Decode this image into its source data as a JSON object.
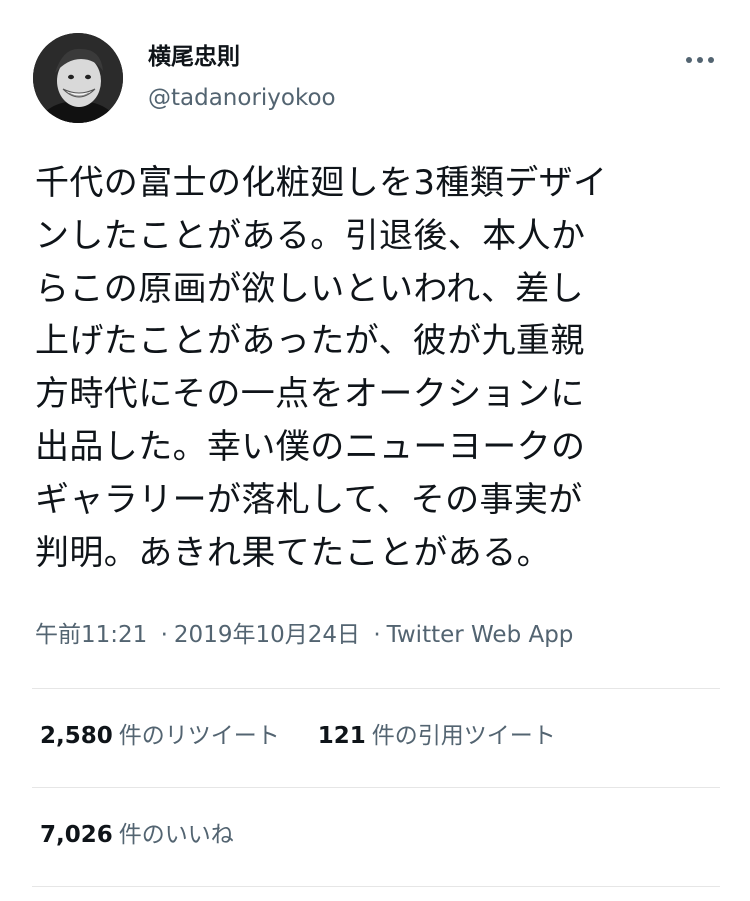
{
  "user": {
    "display_name": "横尾忠則",
    "handle": "@tadanoriyokoo",
    "avatar_icon": "profile-photo"
  },
  "menu": {
    "more_icon": "ellipsis-icon"
  },
  "tweet": {
    "text": "千代の富士の化粧廻しを3種類デザイ\nンしたことがある。引退後、本人か\nらこの原画が欲しいといわれ、差し\n上げたことがあったが、彼が九重親\n方時代にその一点をオークションに\n出品した。幸い僕のニューヨークの\nギャラリーが落札して、その事実が\n判明。あきれ果てたことがある。"
  },
  "meta": {
    "time": "午前11:21",
    "date": "2019年10月24日",
    "separator": "·",
    "source": "Twitter Web App"
  },
  "stats": {
    "retweets": {
      "count": "2,580",
      "label": "件のリツイート"
    },
    "quotes": {
      "count": "121",
      "label": "件の引用ツイート"
    },
    "likes": {
      "count": "7,026",
      "label": "件のいいね"
    }
  },
  "colors": {
    "text_primary": "#0f1419",
    "text_secondary": "#536471",
    "divider": "#e6e6e6"
  }
}
